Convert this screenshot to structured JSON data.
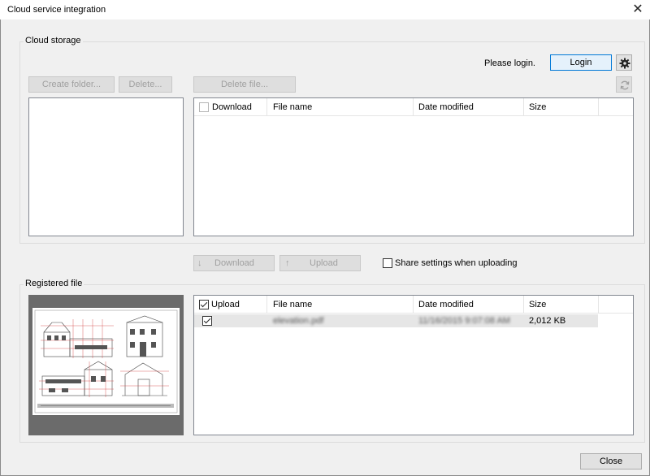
{
  "window": {
    "title": "Cloud service integration",
    "close_glyph": "✕"
  },
  "cloud_storage": {
    "group_label": "Cloud storage",
    "login_status": "Please login.",
    "login_button": "Login",
    "create_folder_button": "Create folder...",
    "delete_button": "Delete...",
    "delete_file_button": "Delete file...",
    "columns": [
      "Download",
      "File name",
      "Date modified",
      "Size"
    ]
  },
  "transfer": {
    "download_button": "Download",
    "download_arrow": "↓",
    "upload_button": "Upload",
    "upload_arrow": "↑",
    "share_settings_label": "Share settings when uploading"
  },
  "registered_file": {
    "group_label": "Registered file",
    "columns": [
      "Upload",
      "File name",
      "Date modified",
      "Size"
    ],
    "rows": [
      {
        "file_name": "elevation.pdf",
        "date_modified": "11/16/2015 9:07:08 AM",
        "size": "2,012 KB",
        "checked": true
      }
    ]
  },
  "footer": {
    "close_button": "Close"
  }
}
